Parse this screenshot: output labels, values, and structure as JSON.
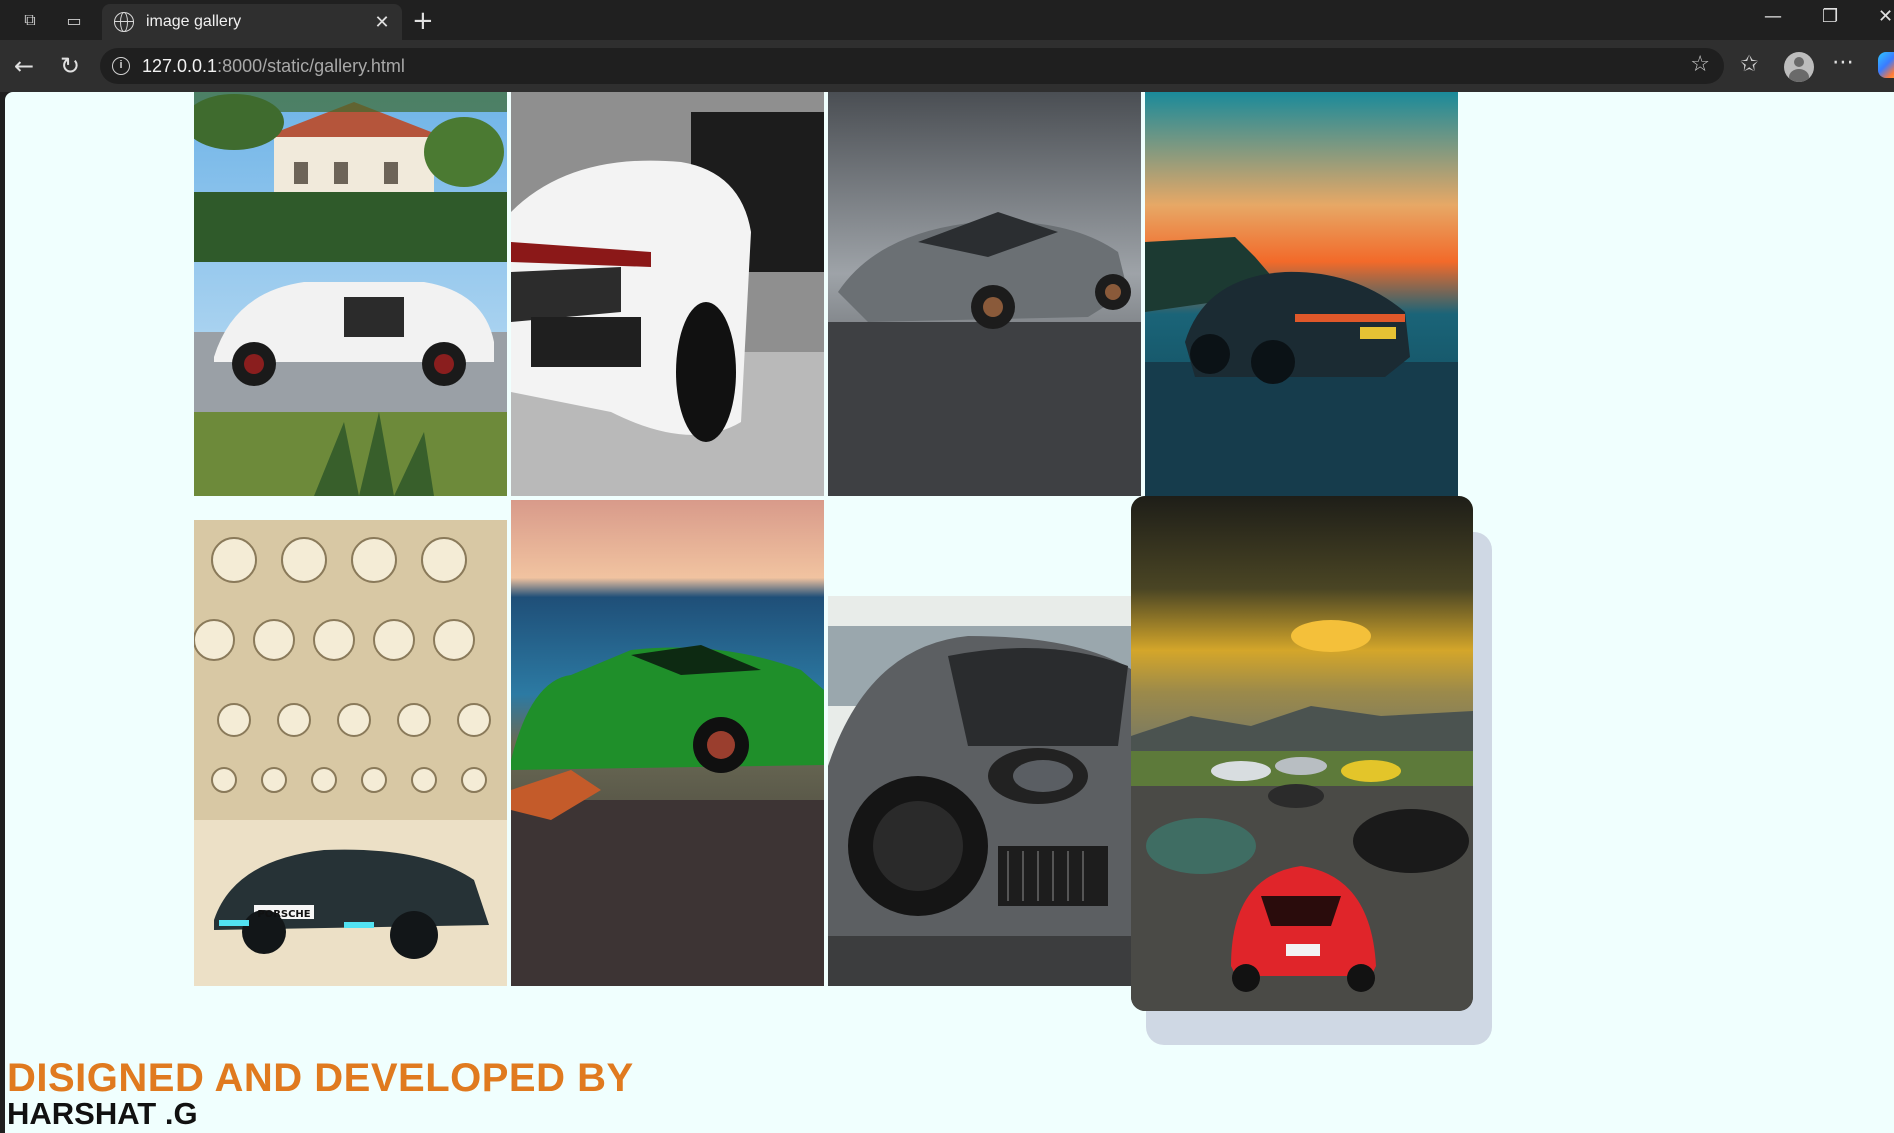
{
  "browser": {
    "tab_title": "image gallery",
    "url_host": "127.0.0.1",
    "url_path": ":8000/static/gallery.html"
  },
  "gallery": {
    "images": [
      {
        "name": "gallery-image-1",
        "subject": "white suv in front of villa"
      },
      {
        "name": "gallery-image-2",
        "subject": "white supercar rear"
      },
      {
        "name": "gallery-image-3",
        "subject": "grey supercar on road"
      },
      {
        "name": "gallery-image-4",
        "subject": "dark sports car at sunset"
      },
      {
        "name": "gallery-image-5",
        "subject": "porsche in parking garage"
      },
      {
        "name": "gallery-image-6",
        "subject": "green supercar by the sea"
      },
      {
        "name": "gallery-image-7",
        "subject": "grey porsche front"
      },
      {
        "name": "gallery-image-8",
        "subject": "group of sports cars, hovered"
      }
    ],
    "plate_text": "PORSCHE"
  },
  "footer": {
    "heading": "DISIGNED AND DEVELOPED BY",
    "name": "HARSHAT .G"
  },
  "colors": {
    "page_background": "#f0fffe",
    "heading": "#e07a1f",
    "name": "#111111"
  }
}
